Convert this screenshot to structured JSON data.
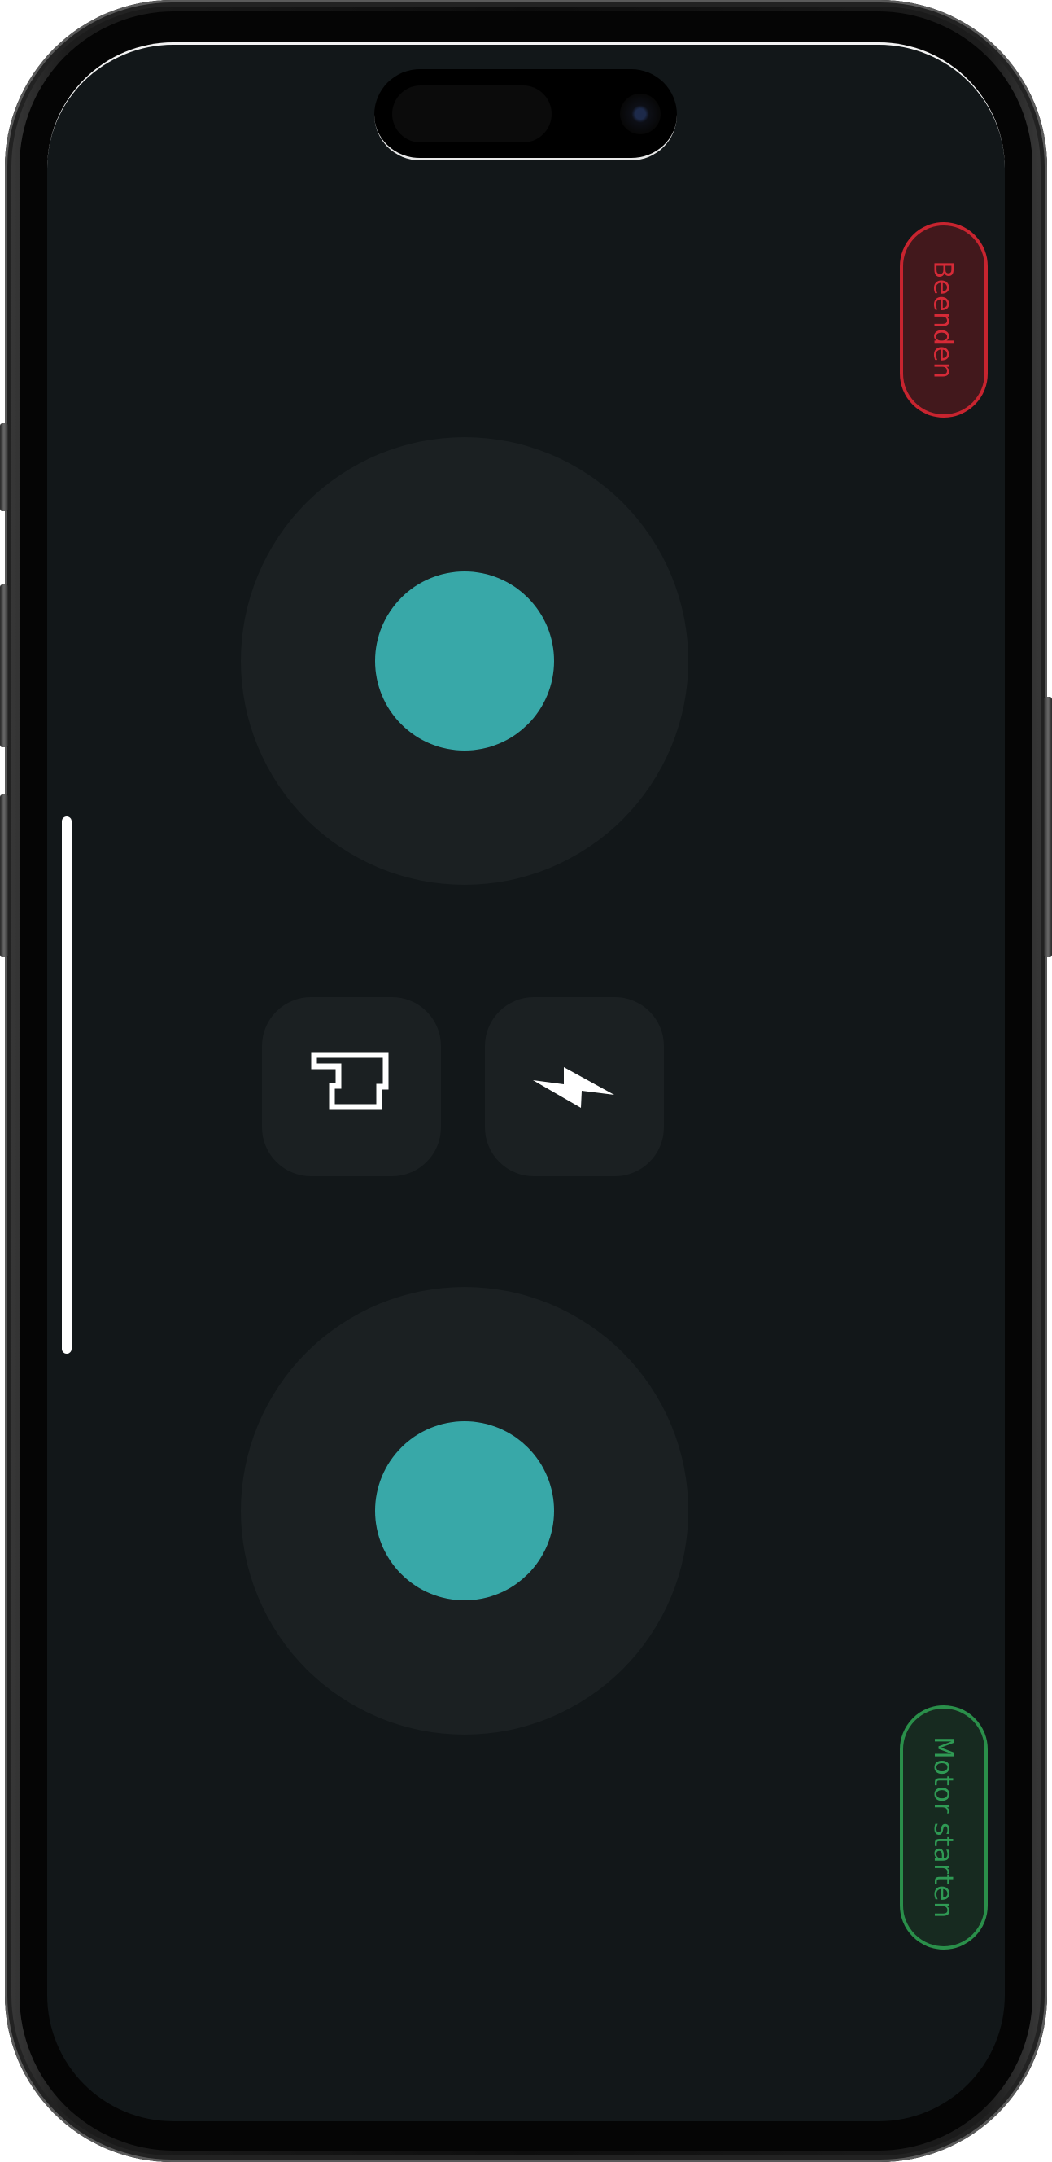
{
  "controls": {
    "exit_label": "Beenden",
    "start_motor_label": "Motor starten"
  },
  "icons": {
    "left_action": "parking-brake-icon",
    "right_action": "boost-lightning-icon"
  },
  "colors": {
    "screen_background": "#121719",
    "control_surface": "#1b2022",
    "joystick_knob": "#38a8a8",
    "exit_border": "#c8242f",
    "exit_text": "#d62a37",
    "start_border": "#2a8f4a",
    "start_text": "#2f9a54"
  }
}
